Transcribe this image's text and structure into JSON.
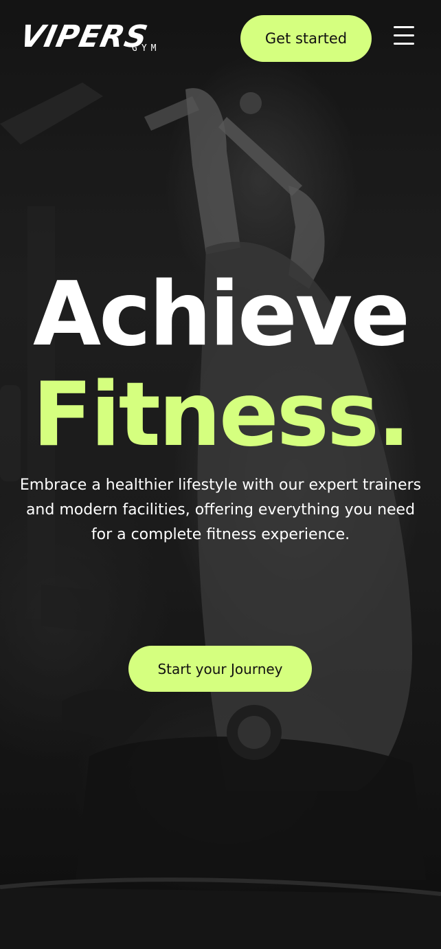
{
  "colors": {
    "accent": "#d5ff7f",
    "text": "#ffffff",
    "button_text": "#111111"
  },
  "header": {
    "logo_main": "VIPERS",
    "logo_sub": "GYM",
    "cta_label": "Get started",
    "menu_icon": "hamburger-menu-icon"
  },
  "hero": {
    "line1": "Achieve",
    "line2": "Fitness.",
    "description": "Embrace a healthier lifestyle with our expert trainers and modern facilities, offering everything you need for a complete fitness experience.",
    "cta_label": "Start your Journey"
  }
}
